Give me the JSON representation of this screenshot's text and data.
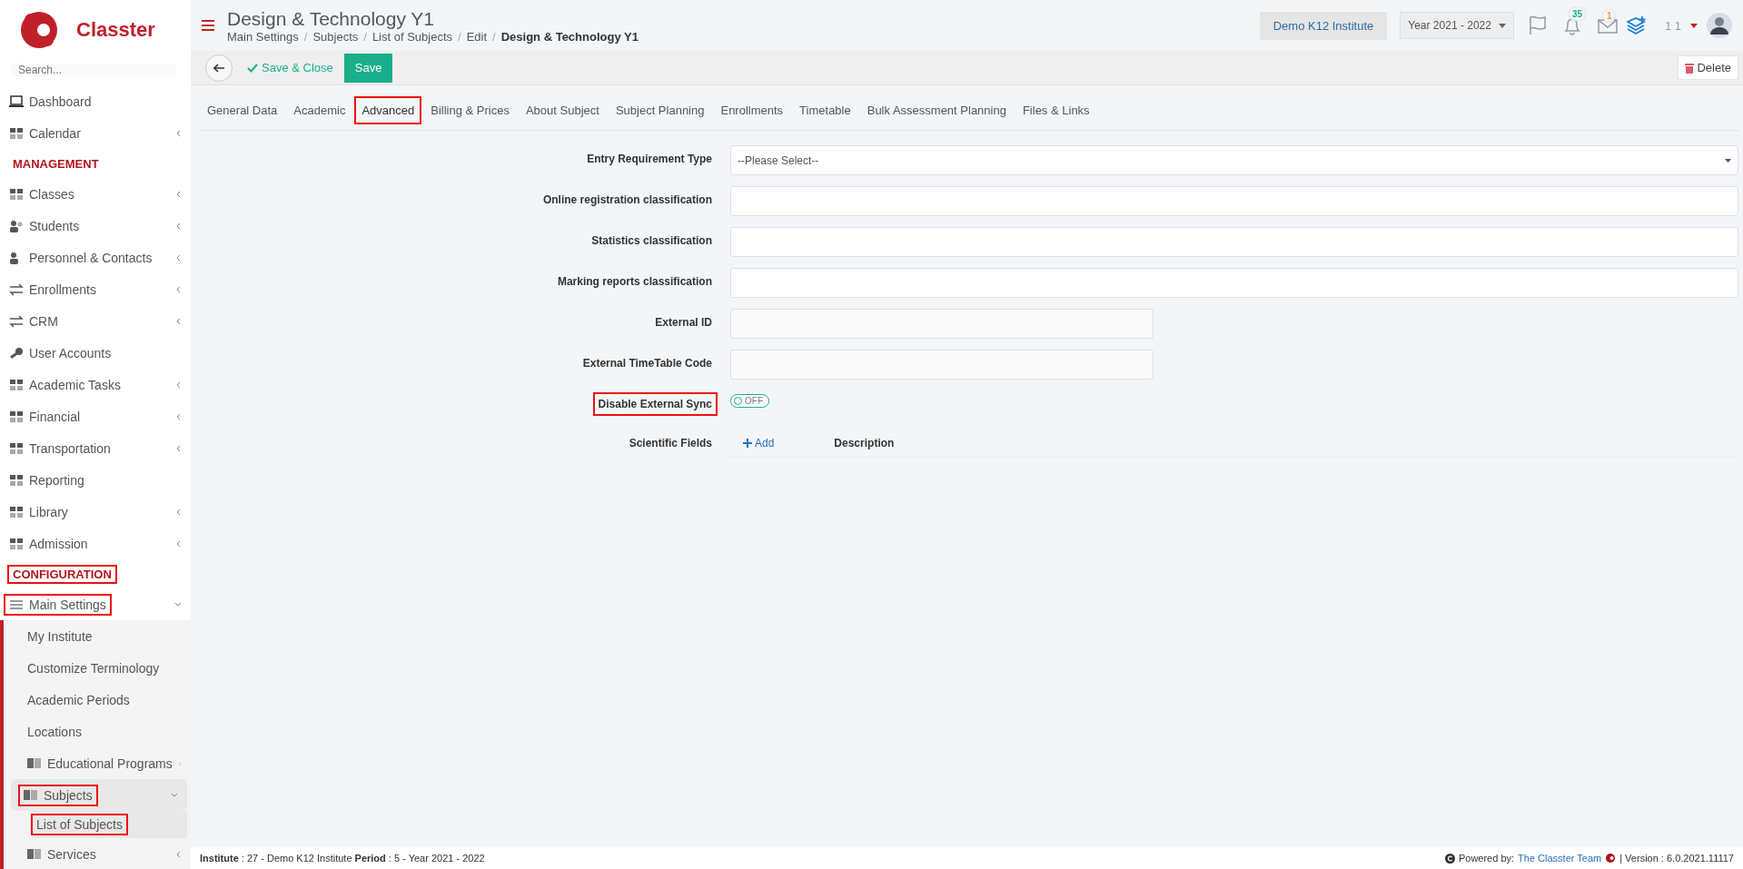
{
  "sidebar": {
    "brand": "Classter",
    "search": {
      "placeholder": "Search..."
    },
    "nav": [
      {
        "kind": "item",
        "label": "Dashboard",
        "expandable": false,
        "selected": false,
        "highlighted": false
      },
      {
        "kind": "item",
        "label": "Calendar",
        "expandable": true,
        "expanded": false,
        "selected": false,
        "highlighted": false
      },
      {
        "kind": "heading",
        "label": "MANAGEMENT",
        "highlighted": false
      },
      {
        "kind": "item",
        "label": "Classes",
        "expandable": true,
        "expanded": false,
        "selected": false,
        "highlighted": false
      },
      {
        "kind": "item",
        "label": "Students",
        "expandable": true,
        "expanded": false,
        "selected": false,
        "highlighted": false
      },
      {
        "kind": "item",
        "label": "Personnel & Contacts",
        "expandable": true,
        "expanded": false,
        "selected": false,
        "highlighted": false
      },
      {
        "kind": "item",
        "label": "Enrollments",
        "expandable": true,
        "expanded": false,
        "selected": false,
        "highlighted": false
      },
      {
        "kind": "item",
        "label": "CRM",
        "expandable": true,
        "expanded": false,
        "selected": false,
        "highlighted": false
      },
      {
        "kind": "item",
        "label": "User Accounts",
        "expandable": false,
        "selected": false,
        "highlighted": false
      },
      {
        "kind": "item",
        "label": "Academic Tasks",
        "expandable": true,
        "expanded": false,
        "selected": false,
        "highlighted": false
      },
      {
        "kind": "item",
        "label": "Financial",
        "expandable": true,
        "expanded": false,
        "selected": false,
        "highlighted": false
      },
      {
        "kind": "item",
        "label": "Transportation",
        "expandable": true,
        "expanded": false,
        "selected": false,
        "highlighted": false
      },
      {
        "kind": "item",
        "label": "Reporting",
        "expandable": false,
        "selected": false,
        "highlighted": false
      },
      {
        "kind": "item",
        "label": "Library",
        "expandable": true,
        "expanded": false,
        "selected": false,
        "highlighted": false
      },
      {
        "kind": "item",
        "label": "Admission",
        "expandable": true,
        "expanded": false,
        "selected": false,
        "highlighted": false
      },
      {
        "kind": "heading",
        "label": "CONFIGURATION",
        "highlighted": true
      },
      {
        "kind": "item",
        "label": "Main Settings",
        "expandable": true,
        "expanded": true,
        "selected": false,
        "highlighted": true,
        "children": [
          {
            "label": "My Institute",
            "icon": false,
            "expandable": false,
            "selected": false,
            "highlighted": false
          },
          {
            "label": "Customize Terminology",
            "icon": false,
            "expandable": false,
            "selected": false,
            "highlighted": false
          },
          {
            "label": "Academic Periods",
            "icon": false,
            "expandable": false,
            "selected": false,
            "highlighted": false
          },
          {
            "label": "Locations",
            "icon": false,
            "expandable": false,
            "selected": false,
            "highlighted": false
          },
          {
            "label": "Educational Programs",
            "icon": true,
            "expandable": true,
            "expanded": false,
            "selected": false,
            "highlighted": false
          },
          {
            "label": "Subjects",
            "icon": true,
            "expandable": true,
            "expanded": true,
            "selected": true,
            "highlighted": true,
            "children": [
              {
                "label": "List of Subjects",
                "selected": true,
                "highlighted": true
              }
            ]
          },
          {
            "label": "Services",
            "icon": true,
            "expandable": true,
            "expanded": false,
            "selected": false,
            "highlighted": false
          }
        ]
      }
    ]
  },
  "header": {
    "title": "Design & Technology Y1",
    "breadcrumbs": [
      "Main Settings",
      "Subjects",
      "List of Subjects",
      "Edit",
      "Design & Technology Y1"
    ],
    "breadcrumb_separator": "/",
    "institute": "Demo K12 Institute",
    "year": "Year 2021 - 2022",
    "notifications_count": "35",
    "messages_count": "1",
    "user": "1 1"
  },
  "toolbar": {
    "save_close": "Save & Close",
    "save": "Save",
    "delete": "Delete"
  },
  "tabs": [
    {
      "label": "General Data",
      "selected": false,
      "highlighted": false
    },
    {
      "label": "Academic",
      "selected": false,
      "highlighted": false
    },
    {
      "label": "Advanced",
      "selected": true,
      "highlighted": true
    },
    {
      "label": "Billing & Prices",
      "selected": false,
      "highlighted": false
    },
    {
      "label": "About Subject",
      "selected": false,
      "highlighted": false
    },
    {
      "label": "Subject Planning",
      "selected": false,
      "highlighted": false
    },
    {
      "label": "Enrollments",
      "selected": false,
      "highlighted": false
    },
    {
      "label": "Timetable",
      "selected": false,
      "highlighted": false
    },
    {
      "label": "Bulk Assessment Planning",
      "selected": false,
      "highlighted": false
    },
    {
      "label": "Files & Links",
      "selected": false,
      "highlighted": false
    }
  ],
  "form": [
    {
      "kind": "select",
      "label": "Entry Requirement Type",
      "placeholder": "--Please Select--",
      "highlighted": false
    },
    {
      "kind": "text",
      "label": "Online registration classification",
      "highlighted": false
    },
    {
      "kind": "text",
      "label": "Statistics classification",
      "highlighted": false
    },
    {
      "kind": "text",
      "label": "Marking reports classification",
      "highlighted": false
    },
    {
      "kind": "short",
      "label": "External ID",
      "highlighted": false
    },
    {
      "kind": "short",
      "label": "External TimeTable Code",
      "highlighted": false
    },
    {
      "kind": "toggle",
      "label": "Disable External Sync",
      "on": false,
      "state": "OFF",
      "highlighted": true
    },
    {
      "kind": "list",
      "label": "Scientific Fields",
      "add": "Add",
      "column": "Description",
      "highlighted": false
    }
  ],
  "footer": {
    "info": "**Institute** : 27 - Demo K12 Institute **Period** : 5 - Year 2021 - 2022",
    "powered": "Powered by:",
    "team": "The Classter Team",
    "version": "| Version : 6.0.2021.11117"
  }
}
